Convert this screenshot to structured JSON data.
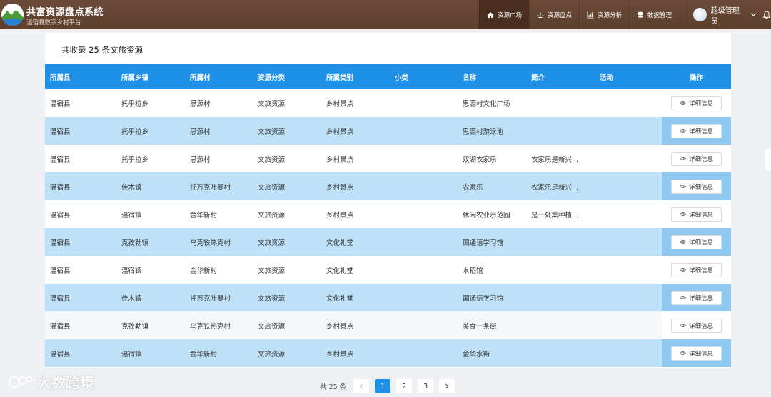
{
  "header": {
    "title": "共富资源盘点系统",
    "subtitle": "温宿县数字乡村平台",
    "nav": [
      {
        "label": "资源广场",
        "icon": "home-icon",
        "active": true
      },
      {
        "label": "资源盘点",
        "icon": "scale-icon",
        "active": false
      },
      {
        "label": "资源分析",
        "icon": "bar-chart-icon",
        "active": false
      },
      {
        "label": "数据管理",
        "icon": "database-icon",
        "active": false
      }
    ],
    "user_name": "超级管理员"
  },
  "summary": "共收录 25 条文旅资源",
  "table": {
    "columns": [
      "所属县",
      "所属乡镇",
      "所属村",
      "资源分类",
      "所属类别",
      "小类",
      "名称",
      "简介",
      "活动",
      "操作"
    ],
    "detail_label": "详细信息",
    "rows": [
      [
        "温宿县",
        "托乎拉乡",
        "思源村",
        "文旅资源",
        "乡村景点",
        "",
        "思源村文化广场",
        "",
        ""
      ],
      [
        "温宿县",
        "托乎拉乡",
        "思源村",
        "文旅资源",
        "乡村景点",
        "",
        "思源村游泳池",
        "",
        ""
      ],
      [
        "温宿县",
        "托乎拉乡",
        "思源村",
        "文旅资源",
        "乡村景点",
        "",
        "双湖农家乐",
        "农家乐是新兴...",
        ""
      ],
      [
        "温宿县",
        "佳木镇",
        "托万克吐曼村",
        "文旅资源",
        "乡村景点",
        "",
        "农家乐",
        "农家乐是新兴...",
        ""
      ],
      [
        "温宿县",
        "温宿镇",
        "金华新村",
        "文旅资源",
        "乡村景点",
        "",
        "休闲农业示范园",
        "是一处集种植...",
        ""
      ],
      [
        "温宿县",
        "克孜勒镇",
        "乌克铁热克村",
        "文旅资源",
        "文化礼堂",
        "",
        "国通语学习馆",
        "",
        ""
      ],
      [
        "温宿县",
        "温宿镇",
        "金华新村",
        "文旅资源",
        "文化礼堂",
        "",
        "水稻馆",
        "",
        ""
      ],
      [
        "温宿县",
        "佳木镇",
        "托万克吐曼村",
        "文旅资源",
        "文化礼堂",
        "",
        "国通语学习馆",
        "",
        ""
      ],
      [
        "温宿县",
        "克孜勒镇",
        "乌克铁热克村",
        "文旅资源",
        "乡村景点",
        "",
        "美食一条街",
        "",
        ""
      ],
      [
        "温宿县",
        "温宿镇",
        "金华新村",
        "文旅资源",
        "乡村景点",
        "",
        "金华水街",
        "",
        ""
      ]
    ]
  },
  "pagination": {
    "total_label": "共 25 条",
    "pages": [
      "1",
      "2",
      "3"
    ],
    "current": "1"
  },
  "watermark": "大数跨境",
  "colors": {
    "header_bg": "#5d3f2e",
    "table_header": "#1e90e8",
    "row_highlight": "#bfe1f8"
  }
}
